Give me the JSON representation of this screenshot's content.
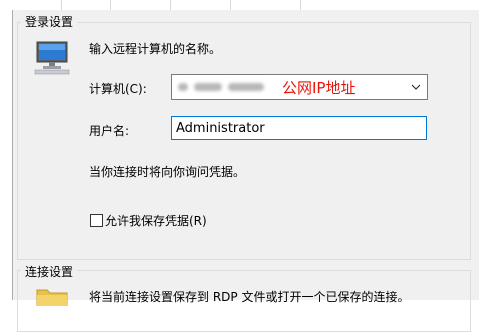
{
  "logon": {
    "group_title": "登录设置",
    "intro": "输入远程计算机的名称。",
    "computer_label": "计算机(C):",
    "computer_value_annotation": "公网IP地址",
    "username_label": "用户名:",
    "username_value": "Administrator",
    "note": "当你连接时将向你询问凭据。",
    "save_credentials_label": "允许我保存凭据(R)"
  },
  "connection": {
    "group_title": "连接设置",
    "description": "将当前连接设置保存到 RDP 文件或打开一个已保存的连接。"
  },
  "colors": {
    "annotation_red": "#e8150a",
    "focus_blue": "#0078d7"
  }
}
